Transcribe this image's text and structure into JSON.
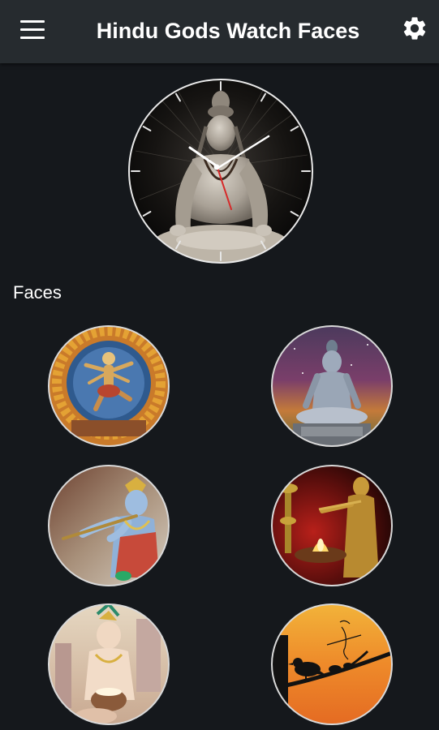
{
  "app_bar": {
    "title": "Hindu Gods Watch Faces",
    "menu_icon": "menu-icon",
    "settings_icon": "gear-icon"
  },
  "preview": {
    "subject": "meditating Shiva",
    "hands": "hour, minute and red second hands"
  },
  "faces_section": {
    "title": "Faces",
    "items": [
      {
        "subject": "Nataraja dancing Shiva"
      },
      {
        "subject": "meditating Shiva on galaxy background"
      },
      {
        "subject": "Krishna playing flute"
      },
      {
        "subject": "golden Krishna with diya lamp"
      },
      {
        "subject": "Bal Krishna (baby Krishna)"
      },
      {
        "subject": "bird silhouette on orange sunset"
      }
    ]
  },
  "colors": {
    "app_bar_bg": "#262b2f",
    "page_bg": "#15181c",
    "text": "#ffffff",
    "second_hand": "#d62a2a"
  }
}
